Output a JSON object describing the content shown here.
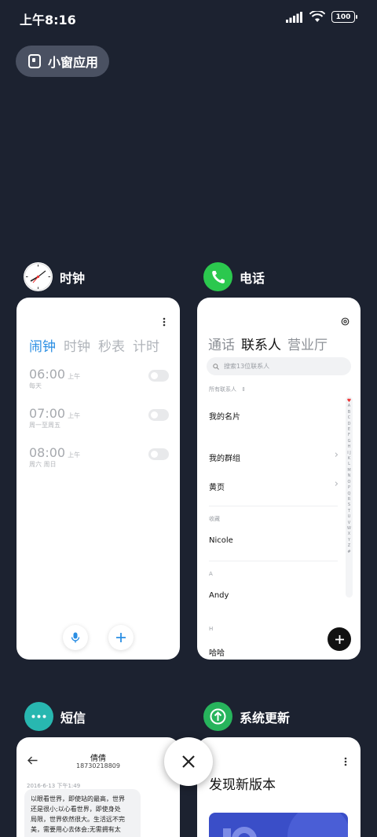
{
  "status_bar": {
    "time": "上午8:16",
    "battery": "100"
  },
  "small_window": {
    "label": "小窗应用"
  },
  "apps": {
    "clock": {
      "name": "时钟",
      "tabs": [
        "闹钟",
        "时钟",
        "秒表",
        "计时"
      ],
      "alarms": [
        {
          "time": "06:00",
          "ampm": "上午",
          "days": "每天"
        },
        {
          "time": "07:00",
          "ampm": "上午",
          "days": "周一至周五"
        },
        {
          "time": "08:00",
          "ampm": "上午",
          "days": "周六 周日"
        }
      ]
    },
    "phone": {
      "name": "电话",
      "tabs": [
        "通话",
        "联系人",
        "营业厅"
      ],
      "search_placeholder": "搜索13位联系人",
      "filter": "所有联系人",
      "my_card": "我的名片",
      "my_groups": "我的群组",
      "yellow_pages": "黄页",
      "favorites_header": "收藏",
      "favorite_contact": "Nicole",
      "section_a": "A",
      "contact_a": "Andy",
      "section_h": "H",
      "contact_h": "哈哈",
      "index_letters": "A B C D E F G H I J K L M N O P Q R S T U V W X Y Z #"
    },
    "sms": {
      "name": "短信",
      "contact_name": "倩倩",
      "contact_number": "18730218809",
      "date": "2016-6-13 下午1:49",
      "message_lines": [
        "以眼看世界，即使站的最高，世界",
        "还是很小;以心看世界，即使身处",
        "局限，世界依然很大。生活远不完",
        "美，需要用心去体会;无需拥有太"
      ]
    },
    "update": {
      "name": "系统更新",
      "title": "发现新版本"
    }
  }
}
